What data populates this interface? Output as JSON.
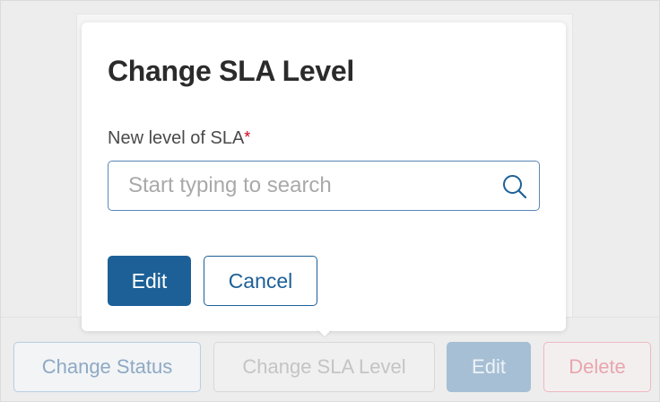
{
  "dialog": {
    "title": "Change SLA Level",
    "field_label": "New level of SLA",
    "required_mark": "*",
    "search_placeholder": "Start typing to search",
    "search_icon": "search-icon",
    "edit_label": "Edit",
    "cancel_label": "Cancel"
  },
  "action_bar": {
    "change_status_label": "Change Status",
    "change_sla_label": "Change SLA Level",
    "edit_label": "Edit",
    "delete_label": "Delete"
  },
  "colors": {
    "primary": "#1d6097",
    "required": "#d0021b"
  }
}
